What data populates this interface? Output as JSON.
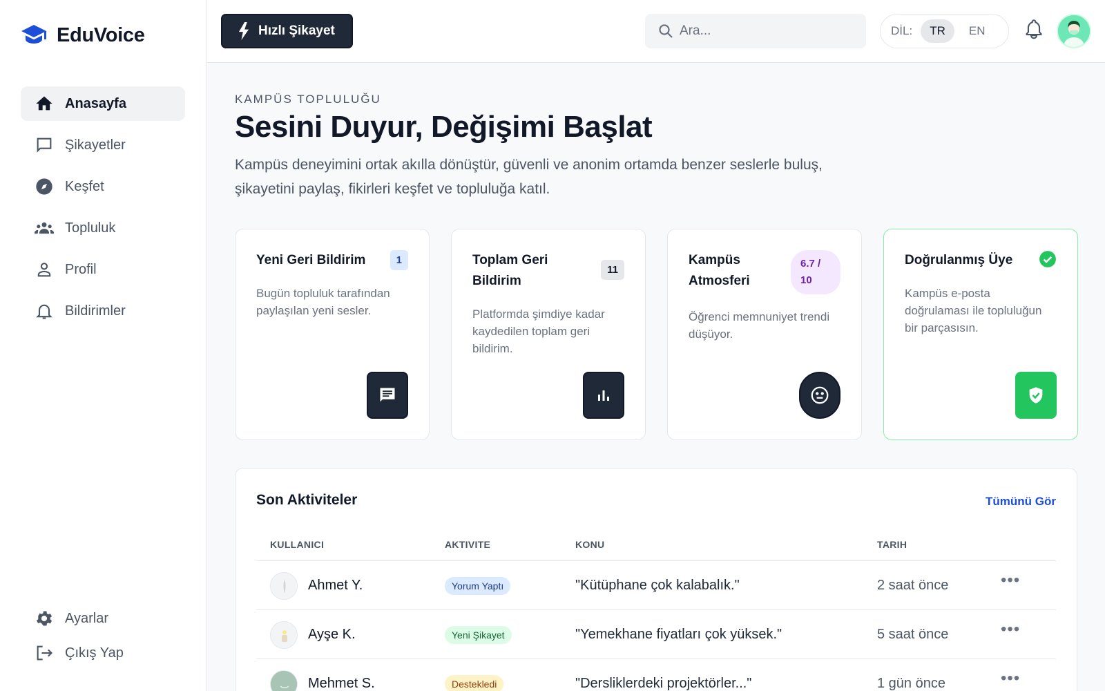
{
  "brand": {
    "name": "EduVoice",
    "accent": "#1d4ed8"
  },
  "sidebar": {
    "items": [
      {
        "label": "Anasayfa",
        "icon": "home-icon",
        "active": true
      },
      {
        "label": "Şikayetler",
        "icon": "chat-icon"
      },
      {
        "label": "Keşfet",
        "icon": "compass-icon"
      },
      {
        "label": "Topluluk",
        "icon": "group-icon"
      },
      {
        "label": "Profil",
        "icon": "person-icon"
      },
      {
        "label": "Bildirimler",
        "icon": "bell-icon"
      }
    ],
    "bottom": [
      {
        "label": "Ayarlar",
        "icon": "gear-icon"
      },
      {
        "label": "Çıkış Yap",
        "icon": "logout-icon"
      }
    ]
  },
  "header": {
    "quick_button": "Hızlı Şikayet",
    "search_placeholder": "Ara...",
    "lang_label": "DİL:",
    "lang_options": [
      "TR",
      "EN"
    ],
    "lang_selected": "TR"
  },
  "hero": {
    "eyebrow": "KAMPÜS TOPLULUĞU",
    "title": "Sesini Duyur, Değişimi Başlat",
    "description": "Kampüs deneyimini ortak akılla dönüştür, güvenli ve anonim ortamda benzer seslerle buluş, şikayetini paylaş, fikirleri keşfet ve topluluğa katıl."
  },
  "cards": [
    {
      "title": "Yeni Geri Bildirim",
      "badge": "1",
      "description": "Bugün topluluk tarafından paylaşılan yeni sesler.",
      "icon": "message-icon"
    },
    {
      "title": "Toplam Geri Bildirim",
      "badge": "11",
      "description": "Platformda şimdiye kadar kaydedilen toplam geri bildirim.",
      "icon": "bar-chart-icon"
    },
    {
      "title": "Kampüs Atmosferi",
      "badge": "6.7 / 10",
      "description": "Öğrenci memnuniyet trendi düşüyor.",
      "icon": "neutral-face-icon"
    },
    {
      "title": "Doğrulanmış Üye",
      "description": "Kampüs e-posta doğrulaması ile topluluğun bir parçasısın.",
      "icon": "shield-check-icon",
      "status_color": "#22c55e"
    }
  ],
  "activity": {
    "title": "Son Aktiviteler",
    "see_all": "Tümünü Gör",
    "columns": [
      "KULLANICI",
      "AKTIVITE",
      "KONU",
      "TARIH"
    ],
    "rows": [
      {
        "user": "Ahmet Y.",
        "action": "Yorum Yaptı",
        "action_color": "blue",
        "topic": "\"Kütüphane çok kalabalık.\"",
        "date": "2 saat önce"
      },
      {
        "user": "Ayşe K.",
        "action": "Yeni Şikayet",
        "action_color": "green",
        "topic": "\"Yemekhane fiyatları çok yüksek.\"",
        "date": "5 saat önce"
      },
      {
        "user": "Mehmet S.",
        "action": "Destekledi",
        "action_color": "yellow",
        "topic": "\"Dersliklerdeki projektörler...\"",
        "date": "1 gün önce"
      }
    ]
  }
}
